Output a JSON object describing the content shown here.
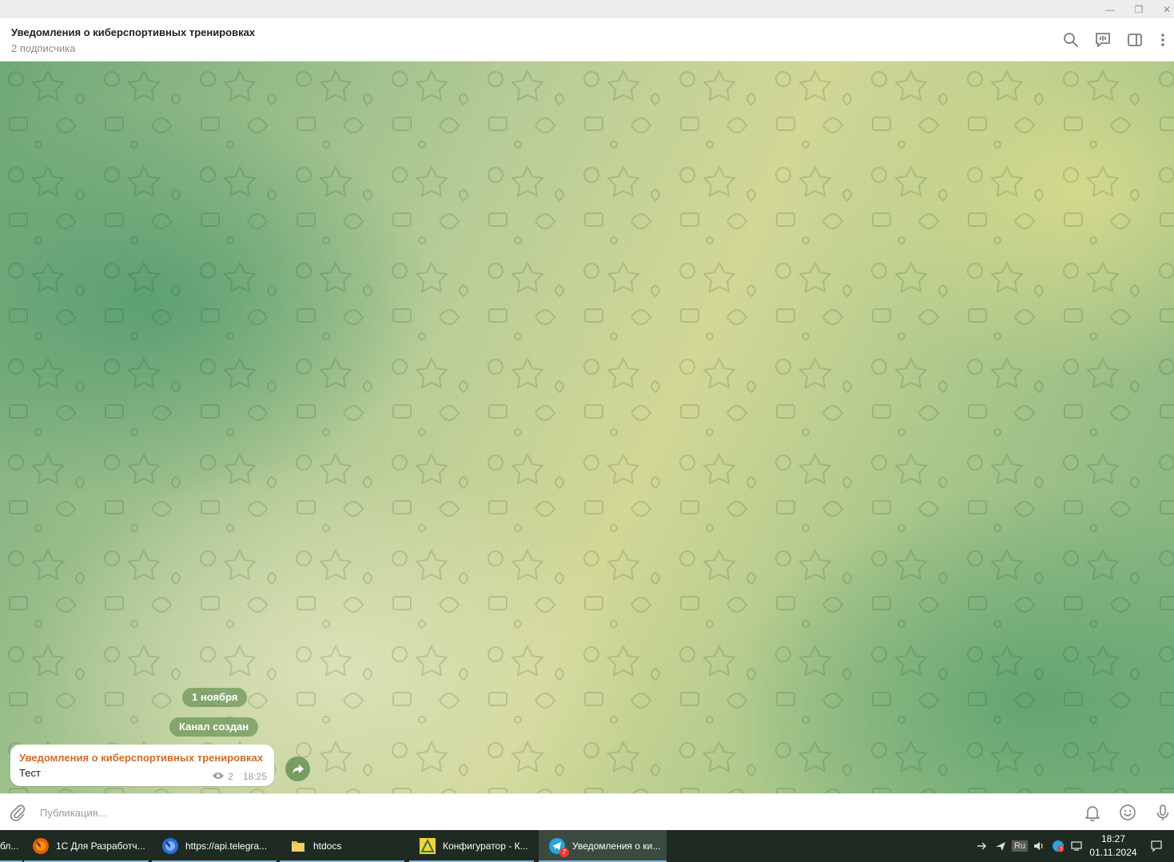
{
  "window": {
    "minimize": "—",
    "restore": "❐",
    "close": "✕"
  },
  "channel": {
    "title": "Уведомления о киберспортивных тренировках",
    "subscribers": "2 подписчика"
  },
  "messages": {
    "date_pill": "1 ноября",
    "service_pill": "Канал создан",
    "post": {
      "author": "Уведомления о киберспортивных тренировках",
      "text": "Тест",
      "views": "2",
      "time": "18:25"
    }
  },
  "composer": {
    "placeholder": "Публикация..."
  },
  "taskbar": {
    "items": [
      {
        "label": "бл..."
      },
      {
        "label": "1С Для Разработч..."
      },
      {
        "label": "https://api.telegra..."
      },
      {
        "label": "htdocs"
      },
      {
        "label": "Конфигуратор - К..."
      },
      {
        "label": "Уведомления о ки...",
        "badge": "7"
      }
    ],
    "lang": "Ru",
    "tray_badge": "7",
    "time": "18:27",
    "date": "01.11.2024"
  },
  "colors": {
    "accent": "#d16b28",
    "pill": "#6e965a",
    "taskbar": "#1f2a22"
  }
}
